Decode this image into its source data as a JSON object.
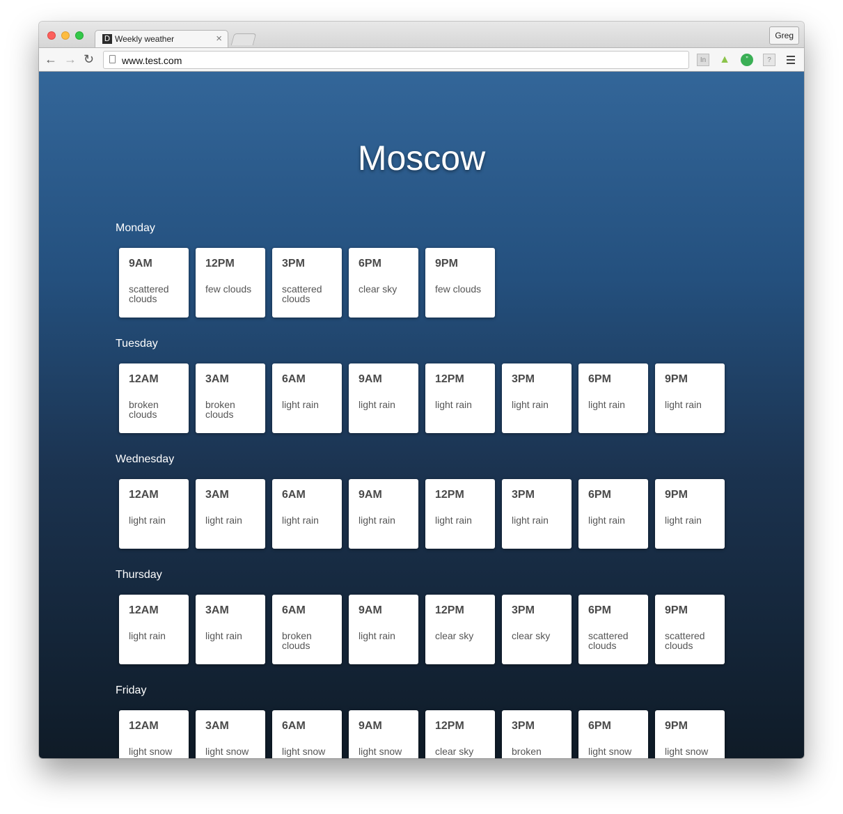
{
  "browser": {
    "tab_title": "Weekly weather",
    "favicon_letter": "D",
    "url": "www.test.com",
    "profile_name": "Greg",
    "extensions": [
      "In",
      "android-icon",
      "hangouts-icon",
      "?"
    ]
  },
  "page": {
    "city": "Moscow",
    "days": [
      {
        "name": "Monday",
        "forecasts": [
          {
            "time": "9AM",
            "condition": "scattered clouds"
          },
          {
            "time": "12PM",
            "condition": "few clouds"
          },
          {
            "time": "3PM",
            "condition": "scattered clouds"
          },
          {
            "time": "6PM",
            "condition": "clear sky"
          },
          {
            "time": "9PM",
            "condition": "few clouds"
          }
        ]
      },
      {
        "name": "Tuesday",
        "forecasts": [
          {
            "time": "12AM",
            "condition": "broken clouds"
          },
          {
            "time": "3AM",
            "condition": "broken clouds"
          },
          {
            "time": "6AM",
            "condition": "light rain"
          },
          {
            "time": "9AM",
            "condition": "light rain"
          },
          {
            "time": "12PM",
            "condition": "light rain"
          },
          {
            "time": "3PM",
            "condition": "light rain"
          },
          {
            "time": "6PM",
            "condition": "light rain"
          },
          {
            "time": "9PM",
            "condition": "light rain"
          }
        ]
      },
      {
        "name": "Wednesday",
        "forecasts": [
          {
            "time": "12AM",
            "condition": "light rain"
          },
          {
            "time": "3AM",
            "condition": "light rain"
          },
          {
            "time": "6AM",
            "condition": "light rain"
          },
          {
            "time": "9AM",
            "condition": "light rain"
          },
          {
            "time": "12PM",
            "condition": "light rain"
          },
          {
            "time": "3PM",
            "condition": "light rain"
          },
          {
            "time": "6PM",
            "condition": "light rain"
          },
          {
            "time": "9PM",
            "condition": "light rain"
          }
        ]
      },
      {
        "name": "Thursday",
        "forecasts": [
          {
            "time": "12AM",
            "condition": "light rain"
          },
          {
            "time": "3AM",
            "condition": "light rain"
          },
          {
            "time": "6AM",
            "condition": "broken clouds"
          },
          {
            "time": "9AM",
            "condition": "light rain"
          },
          {
            "time": "12PM",
            "condition": "clear sky"
          },
          {
            "time": "3PM",
            "condition": "clear sky"
          },
          {
            "time": "6PM",
            "condition": "scattered clouds"
          },
          {
            "time": "9PM",
            "condition": "scattered clouds"
          }
        ]
      },
      {
        "name": "Friday",
        "forecasts": [
          {
            "time": "12AM",
            "condition": "light snow"
          },
          {
            "time": "3AM",
            "condition": "light snow"
          },
          {
            "time": "6AM",
            "condition": "light snow"
          },
          {
            "time": "9AM",
            "condition": "light snow"
          },
          {
            "time": "12PM",
            "condition": "clear sky"
          },
          {
            "time": "3PM",
            "condition": "broken"
          },
          {
            "time": "6PM",
            "condition": "light snow"
          },
          {
            "time": "9PM",
            "condition": "light snow"
          }
        ]
      }
    ]
  }
}
